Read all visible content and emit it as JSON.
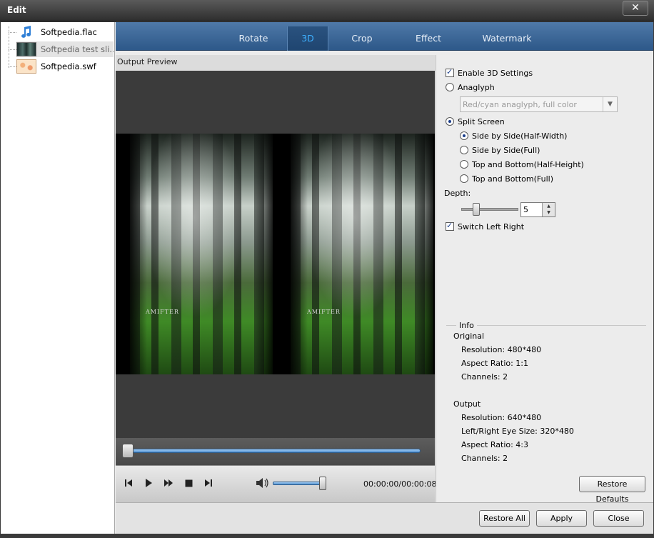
{
  "window": {
    "title": "Edit",
    "close_glyph": "✕"
  },
  "files": [
    {
      "name": "Softpedia.flac",
      "icon": "music-note-icon"
    },
    {
      "name": "Softpedia test sli...",
      "icon": "video-thumbnail-icon"
    },
    {
      "name": "Softpedia.swf",
      "icon": "flash-thumbnail-icon"
    }
  ],
  "tabs": [
    {
      "label": "Rotate"
    },
    {
      "label": "3D",
      "active": true
    },
    {
      "label": "Crop"
    },
    {
      "label": "Effect"
    },
    {
      "label": "Watermark"
    }
  ],
  "preview": {
    "title": "Output Preview",
    "caption_left": "AMIFTER",
    "caption_right": "AMIFTER"
  },
  "player": {
    "timecode": "00:00:00/00:00:08",
    "seek_fraction": 0.0,
    "volume_fraction": 1.0
  },
  "settings": {
    "enable_3d_label": "Enable 3D Settings",
    "enable_3d_checked": true,
    "anaglyph_label": "Anaglyph",
    "anaglyph_selected": false,
    "anaglyph_option": "Red/cyan anaglyph, full color",
    "split_screen_label": "Split Screen",
    "split_screen_selected": true,
    "split_options": [
      {
        "label": "Side by Side(Half-Width)",
        "selected": true
      },
      {
        "label": "Side by Side(Full)",
        "selected": false
      },
      {
        "label": "Top and Bottom(Half-Height)",
        "selected": false
      },
      {
        "label": "Top and Bottom(Full)",
        "selected": false
      }
    ],
    "depth_label": "Depth:",
    "depth_value": "5",
    "switch_lr_label": "Switch Left Right",
    "switch_lr_checked": true
  },
  "info": {
    "title": "Info",
    "original_label": "Original",
    "original": [
      "Resolution: 480*480",
      "Aspect Ratio: 1:1",
      "Channels: 2"
    ],
    "output_label": "Output",
    "output": [
      "Resolution: 640*480",
      "Left/Right Eye Size: 320*480",
      "Aspect Ratio: 4:3",
      "Channels: 2"
    ]
  },
  "buttons": {
    "restore_defaults": "Restore Defaults",
    "restore_all": "Restore All",
    "apply": "Apply",
    "close": "Close"
  },
  "colors": {
    "tab_bar": "#3d6797",
    "active_tab_text": "#3eb0ff",
    "slider_fill": "#6aa6e0"
  }
}
